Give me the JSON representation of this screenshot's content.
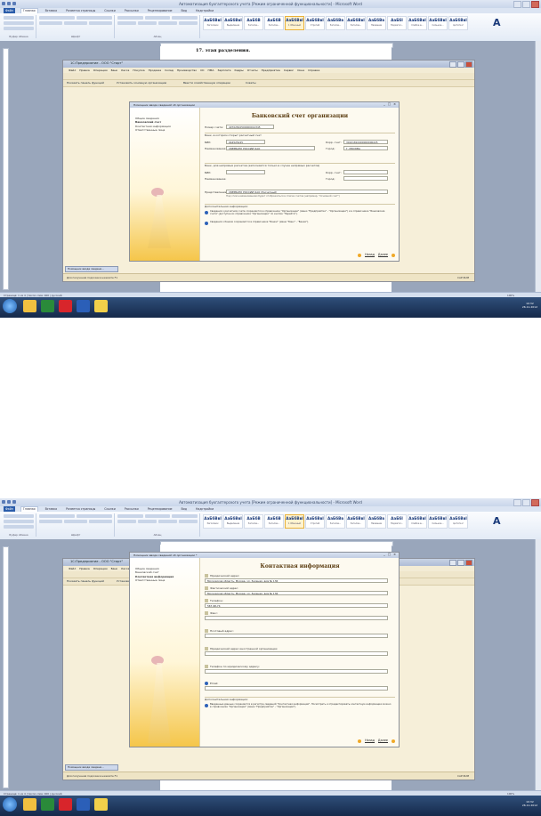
{
  "word": {
    "title": "Автоматизация бухгалтерского учета [Режим ограниченной функциональности] - Microsoft Word",
    "tabs": [
      "Файл",
      "Главная",
      "Вставка",
      "Разметка страницы",
      "Ссылки",
      "Рассылки",
      "Рецензирование",
      "Вид",
      "Надстройки"
    ],
    "styles": [
      {
        "sample": "АаБбВвІ",
        "name": "Заголовок"
      },
      {
        "sample": "АаБбВвІ",
        "name": "Выделение"
      },
      {
        "sample": "АаБбВ",
        "name": "Заголов..."
      },
      {
        "sample": "АаБбВ",
        "name": "Заголов..."
      },
      {
        "sample": "АаБбВвІ",
        "name": "1 Обычный"
      },
      {
        "sample": "АаБбВвІ",
        "name": "Строгий"
      },
      {
        "sample": "АаБбВв",
        "name": "Заголов..."
      },
      {
        "sample": "АаБбВвІ",
        "name": "Заголов..."
      },
      {
        "sample": "АаБбВв",
        "name": "Название"
      },
      {
        "sample": "АаБбІ",
        "name": "Подзагол..."
      },
      {
        "sample": "АаБбВвІ",
        "name": "Слабое в..."
      },
      {
        "sample": "АаБбВвІ",
        "name": "Сильное..."
      },
      {
        "sample": "АаБбВвІ",
        "name": "Цитата 2"
      }
    ],
    "change_styles": "Изменить стили",
    "groups": [
      "Буфер обмена",
      "Шрифт",
      "Абзац",
      "Стили",
      "Редактирование"
    ],
    "page_text_1": "17. этап разделения.",
    "status_left": "Страница: 1 из 4 | Число слов: 400 | русский",
    "zoom": "100%",
    "clock_time": "10:32",
    "clock_date": "26.11.2012"
  },
  "app": {
    "title": "1С:Предприятие - ООО \"Старт\"",
    "menu": [
      "Файл",
      "Правка",
      "Операции",
      "Банк",
      "Касса",
      "Покупка",
      "Продажа",
      "Склад",
      "Производство",
      "ОС",
      "НМА",
      "Зарплата",
      "Кадры",
      "Отчеты",
      "Предприятие",
      "Сервис",
      "Окна",
      "Справка"
    ],
    "toolbar_items": [
      "Показать панель функций",
      "Установить основную организацию",
      "Ввести хозяйственную операцию",
      "Советы"
    ],
    "tab_label": "Помощник ввода сведени...",
    "status_hint": "Для получения подсказки нажмите F1",
    "status_right": "CAP NUM"
  },
  "wizard1": {
    "title": "Помощник ввода сведений об организации",
    "steps": [
      "Общие сведения",
      "Банковский счет",
      "Контактная информация",
      "Ответственные лица"
    ],
    "current_step": 1,
    "heading": "Банковский счет организации",
    "account_label": "Номер счета:",
    "account_value": "40702810500000012345",
    "sec_bank": "Банк, в котором открыт расчетный счет",
    "bik_label": "БИК:",
    "bik_value": "044525225",
    "corr_label": "Корр. счет:",
    "corr_value": "30101810400000000225",
    "name_label": "Наименование:",
    "name_value": "СБЕРБАНК РОССИИ ОАО",
    "city_label": "Город:",
    "city_value": "Г. МОСКВА",
    "sec_corr": "Банк, для непрямых расчетов (заполняется только в случае непрямых расчетов)",
    "bik2_label": "БИК:",
    "corr2_label": "Корр. счет:",
    "name2_label": "Наименование:",
    "city2_label": "Город:",
    "repr_label": "Представление:",
    "repr_value": "СБЕРБАНК РОССИИ ОАО (Расчетный)",
    "repr_hint": "Под этим наименованием будет отображаться в списке счетов (например, \"Основной счет\")",
    "more_info": "Дополнительная информация:",
    "info1": "Сведения о расчетном счете сохраняются в справочнике \"Организации\" (меню \"Предприятие\" - \"Организации\") и в справочнике \"Банковские счета\" (доступен из справочника \"Организации\" по кнопке \"Перейти\").",
    "info2": "Сведения о банках сохраняются в справочнике \"Банки\" (меню \"Банк\" - \"Банки\").",
    "back": "Назад",
    "next": "Далее"
  },
  "wizard2": {
    "title": "Помощник ввода сведений об организации *",
    "steps": [
      "Общие сведения",
      "Банковский счет",
      "Контактная информация",
      "Ответственные лица"
    ],
    "current_step": 2,
    "heading": "Контактная информация",
    "fields": [
      {
        "label": "Юридический адрес:",
        "value": "Московская область, Москва, ул. Зеленая, дом № 136"
      },
      {
        "label": "Фактический адрес:",
        "value": "Московская область, Москва, ул. Зеленая, дом № 136"
      },
      {
        "label": "Телефон:",
        "value": "567-98-74"
      },
      {
        "label": "Факс:",
        "value": ""
      },
      {
        "label": "Почтовый адрес:",
        "value": ""
      },
      {
        "label": "Юридический адрес иностранной организации:",
        "value": ""
      },
      {
        "label": "Телефон по юридическому адресу:",
        "value": ""
      },
      {
        "label": "Email:",
        "value": ""
      }
    ],
    "more_info": "Дополнительная информация:",
    "info1": "Введенные данные сохраняются в регистре сведений \"Контактная информация\". Посмотреть и отредактировать контактную информацию можно в справочнике \"Организации\" (меню \"Предприятие\" - \"Организации\").",
    "back": "Назад",
    "next": "Далее"
  }
}
